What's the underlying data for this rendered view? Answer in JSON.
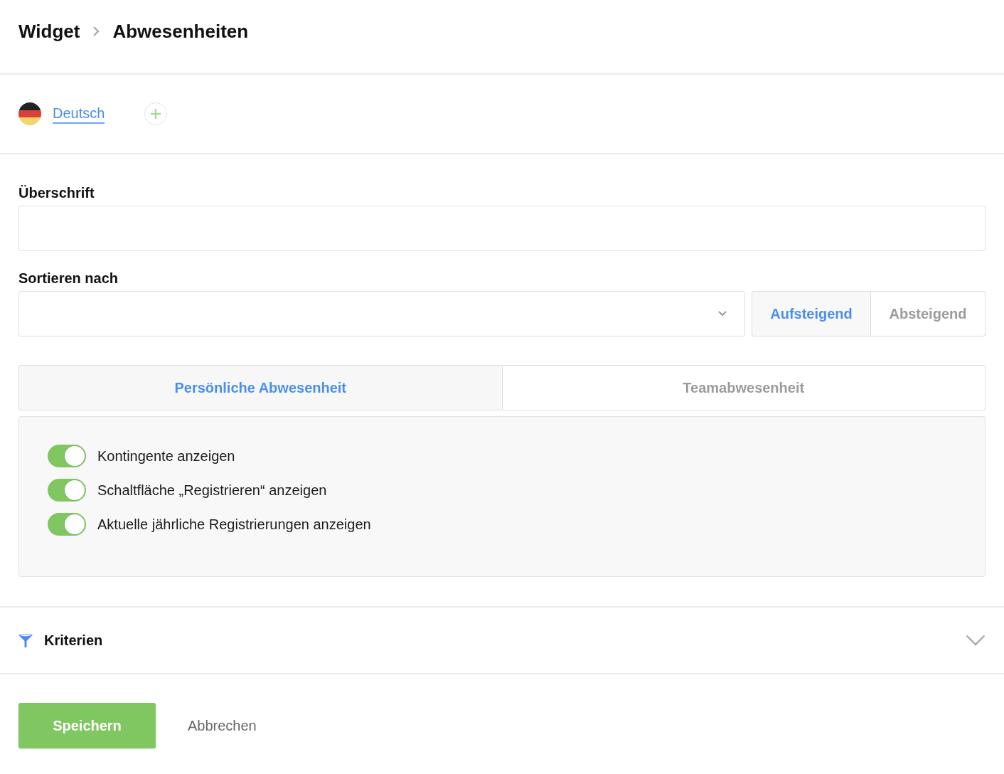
{
  "breadcrumb": [
    {
      "label": "Widget"
    },
    {
      "label": "Abwesenheiten"
    }
  ],
  "languages": [
    {
      "label": "Deutsch",
      "selected": true
    }
  ],
  "heading_field": {
    "label": "Überschrift"
  },
  "sort": {
    "label": "Sortieren nach",
    "order_options": [
      {
        "label": "Aufsteigend",
        "selected": true
      },
      {
        "label": "Absteigend",
        "selected": false
      }
    ]
  },
  "tabs": [
    {
      "label": "Persönliche Abwesenheit",
      "selected": true
    },
    {
      "label": "Teamabwesenheit",
      "selected": false
    }
  ],
  "options": [
    {
      "label": "Kontingente anzeigen",
      "on": true
    },
    {
      "label": "Schaltfläche „Registrieren“ anzeigen",
      "on": true
    },
    {
      "label": "Aktuelle jährliche Registrierungen anzeigen",
      "on": true
    }
  ],
  "criteria": {
    "label": "Kriterien",
    "expanded": false
  },
  "actions": [
    {
      "label": "Speichern",
      "kind": "primary"
    },
    {
      "label": "Abbrechen",
      "kind": "secondary"
    }
  ]
}
